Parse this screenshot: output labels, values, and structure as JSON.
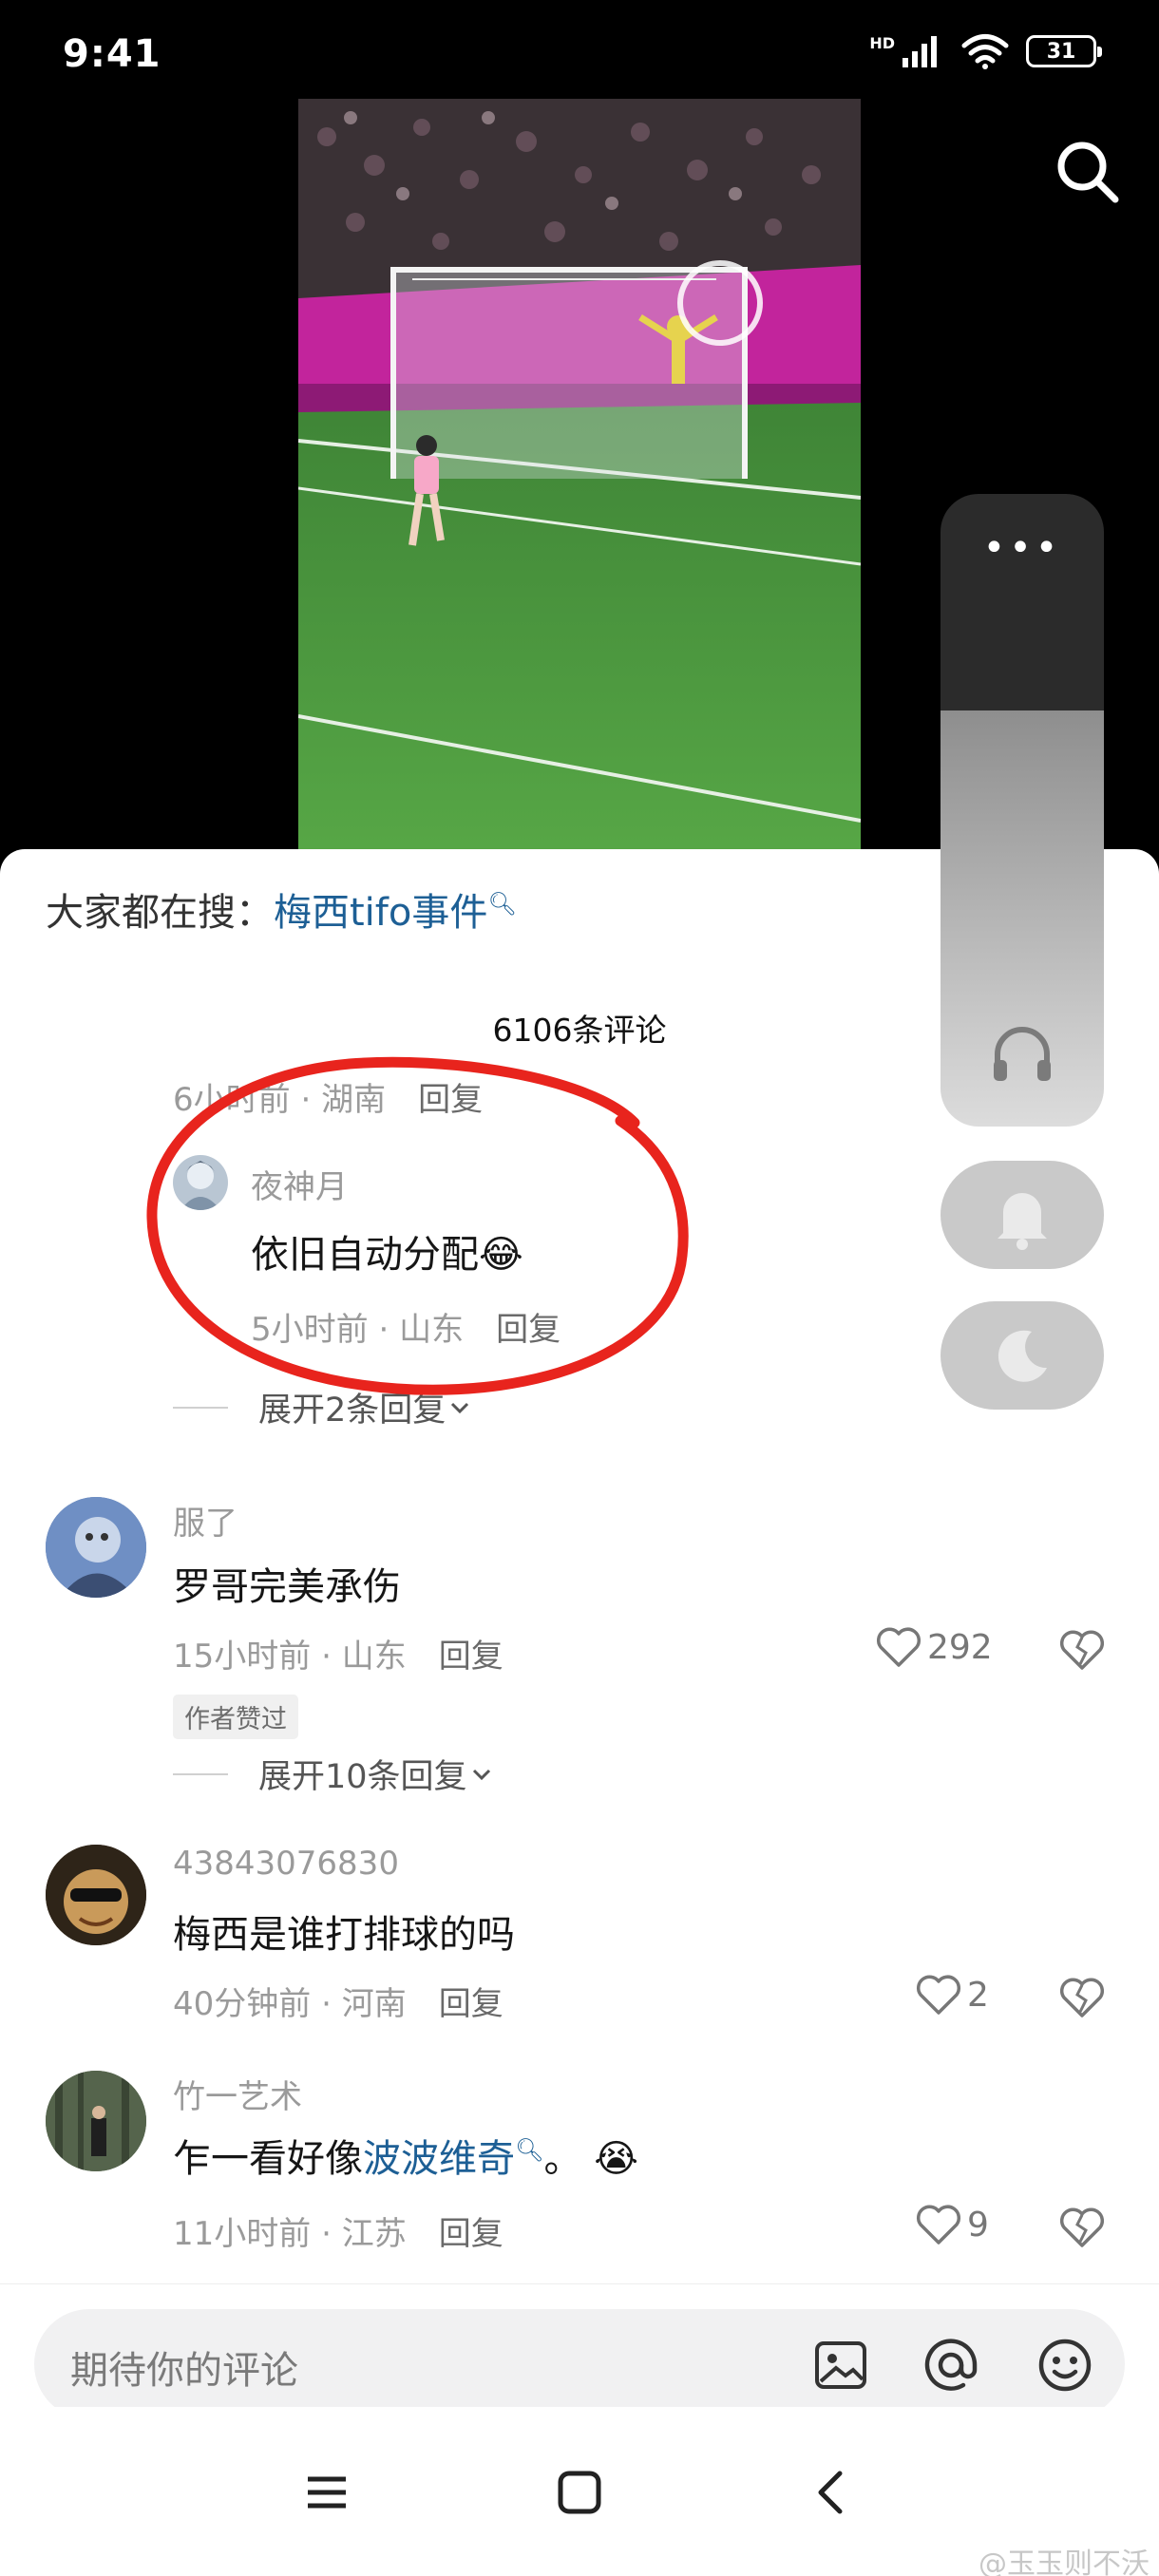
{
  "status_bar": {
    "time": "9:41",
    "network": "HD",
    "battery": "31"
  },
  "hot_search": {
    "prefix": "大家都在搜：",
    "term": "梅西tifo事件"
  },
  "comments_header": {
    "count_label": "6106条评论"
  },
  "comments": [
    {
      "meta_time": "6小时前",
      "meta_location": "湖南",
      "reply": "回复"
    },
    {
      "username": "夜神月",
      "text": "依旧自动分配",
      "emoji": "laugh-tears",
      "meta_time": "5小时前",
      "meta_location": "山东",
      "reply": "回复",
      "expand": "展开2条回复"
    },
    {
      "username": "服了",
      "text": "罗哥完美承伤",
      "meta_time": "15小时前",
      "meta_location": "山东",
      "reply": "回复",
      "likes": "292",
      "tag": "作者赞过",
      "expand": "展开10条回复"
    },
    {
      "username": "43843076830",
      "text": "梅西是谁打排球的吗",
      "meta_time": "40分钟前",
      "meta_location": "河南",
      "reply": "回复",
      "likes": "2"
    },
    {
      "username": "竹一艺术",
      "text_before": "乍一看好像",
      "text_link": "波波维奇",
      "text_after": "。",
      "emoji": "crying-face",
      "meta_time": "11小时前",
      "meta_location": "江苏",
      "reply": "回复",
      "likes": "9"
    }
  ],
  "input": {
    "placeholder": "期待你的评论"
  },
  "watermark": "@玉玉则不沃",
  "icons": [
    "search-icon",
    "more-dots-icon",
    "headphone-icon",
    "bell-icon",
    "moon-icon",
    "image-icon",
    "at-icon",
    "emoji-icon",
    "heart-icon",
    "broken-heart-icon",
    "menu-icon",
    "home-square-icon",
    "back-icon"
  ],
  "colors": {
    "link": "#1d5f95",
    "annotation_red": "#e8241d"
  }
}
